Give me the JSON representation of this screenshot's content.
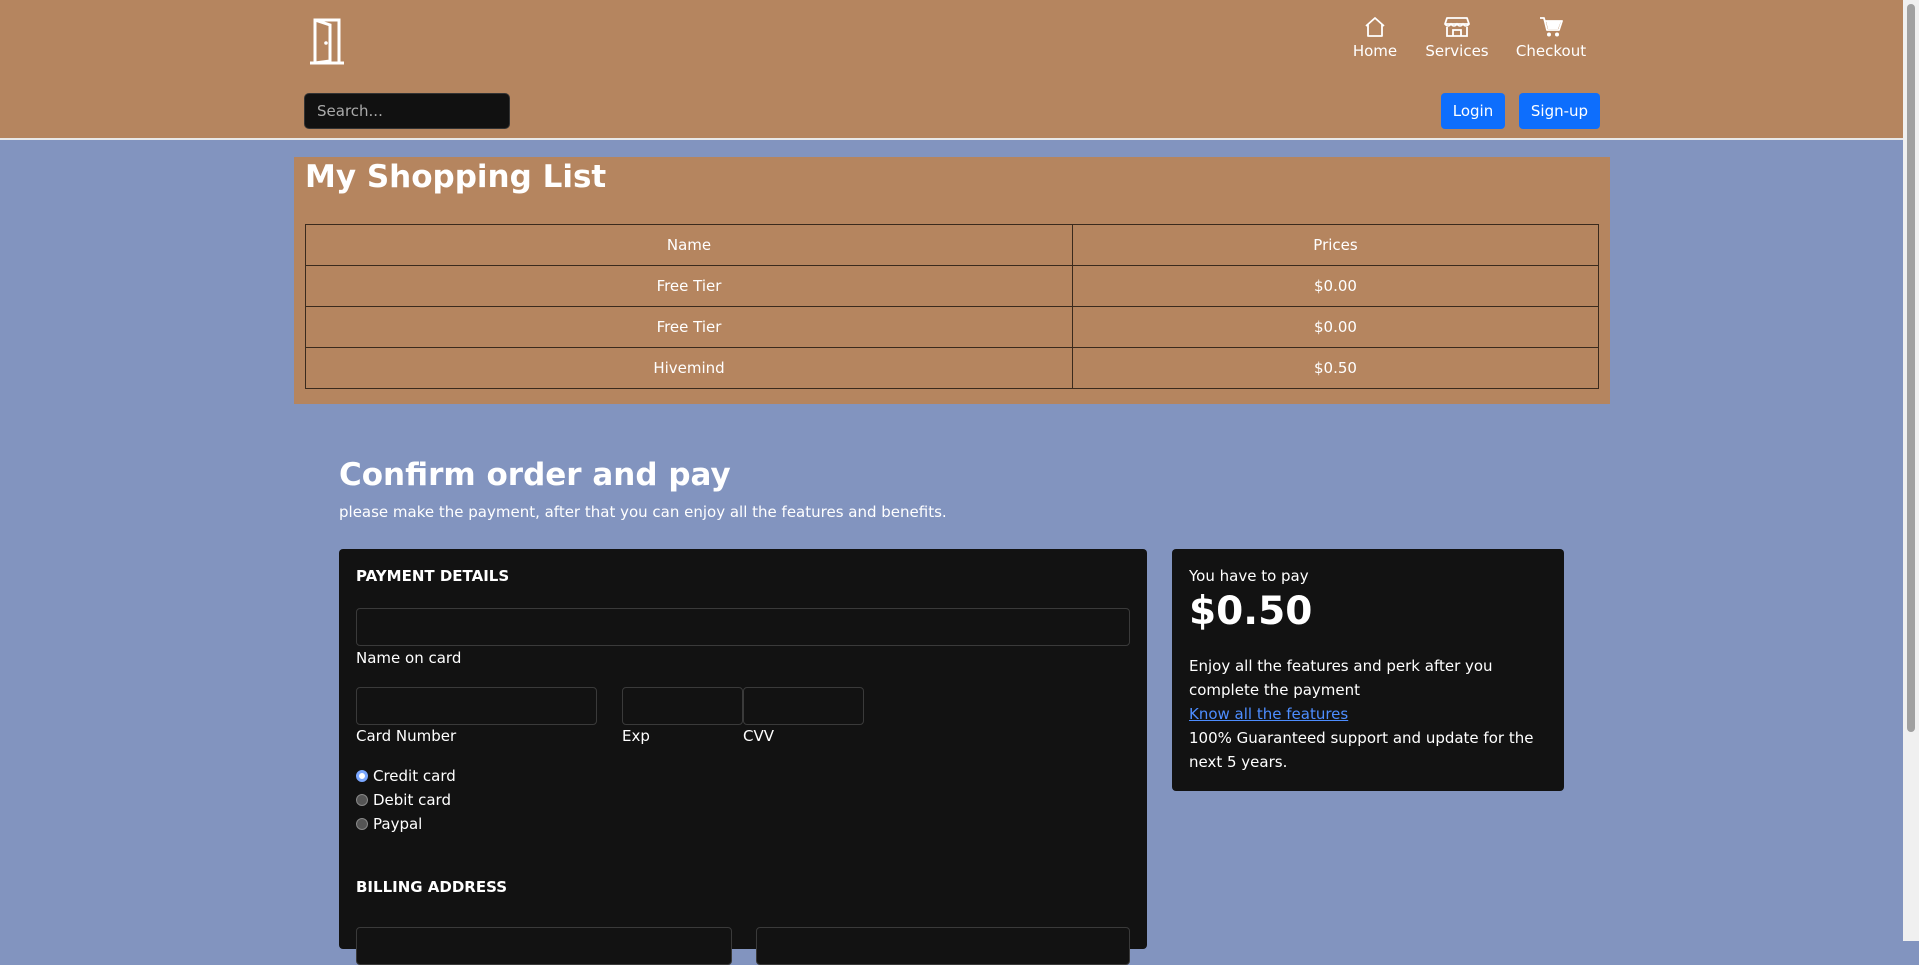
{
  "header": {
    "logo_icon": "door-icon",
    "nav": [
      {
        "label": "Home",
        "icon": "home-icon"
      },
      {
        "label": "Services",
        "icon": "store-icon"
      },
      {
        "label": "Checkout",
        "icon": "cart-icon"
      }
    ],
    "search_placeholder": "Search...",
    "login_label": "Login",
    "signup_label": "Sign-up",
    "bg_color": "#b5855f",
    "button_color": "#0d6efd"
  },
  "shopping_list": {
    "title": "My Shopping List",
    "columns": [
      "Name",
      "Prices"
    ],
    "rows": [
      {
        "name": "Free Tier",
        "price": "$0.00"
      },
      {
        "name": "Free Tier",
        "price": "$0.00"
      },
      {
        "name": "Hivemind",
        "price": "$0.50"
      }
    ]
  },
  "confirm": {
    "title": "Confirm order and pay",
    "subtitle": "please make the payment, after that you can enjoy all the features and benefits."
  },
  "payment": {
    "section_title": "PAYMENT DETAILS",
    "name_label": "Name on card",
    "card_number_label": "Card Number",
    "exp_label": "Exp",
    "cvv_label": "CVV",
    "methods": [
      {
        "label": "Credit card",
        "selected": true
      },
      {
        "label": "Debit card",
        "selected": false
      },
      {
        "label": "Paypal",
        "selected": false
      }
    ],
    "billing_title": "BILLING ADDRESS"
  },
  "summary": {
    "label": "You have to pay",
    "amount": "$0.50",
    "description": "Enjoy all the features and perk after you complete the payment",
    "link": "Know all the features",
    "guarantee": "100% Guaranteed support and update for the next 5 years."
  }
}
